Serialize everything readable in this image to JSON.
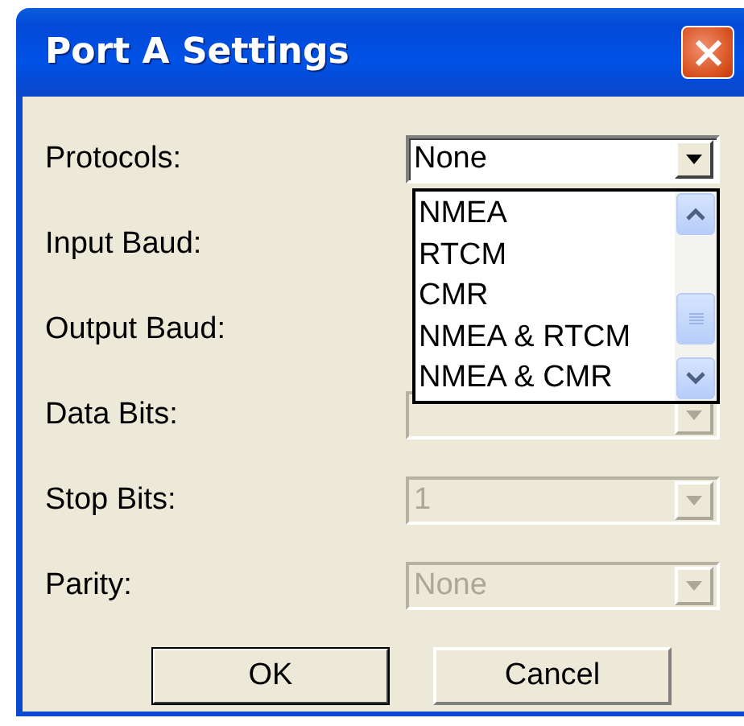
{
  "window": {
    "title": "Port A Settings"
  },
  "fields": [
    {
      "kind": "combo",
      "label": "Protocols:",
      "value": "None",
      "disabled": false,
      "expanded": true,
      "options": [
        "NMEA",
        "RTCM",
        "CMR",
        "NMEA & RTCM",
        "NMEA & CMR"
      ]
    },
    {
      "kind": "label",
      "label": "Input Baud:"
    },
    {
      "kind": "label",
      "label": "Output Baud:"
    },
    {
      "kind": "combo",
      "label": "Data Bits:",
      "disabled": true
    },
    {
      "kind": "combo",
      "label": "Stop Bits:",
      "value": "1",
      "disabled": true
    },
    {
      "kind": "combo",
      "label": "Parity:",
      "value": "None",
      "disabled": true
    }
  ],
  "buttons": [
    {
      "label": "OK",
      "default": true
    },
    {
      "label": "Cancel",
      "default": false
    }
  ]
}
